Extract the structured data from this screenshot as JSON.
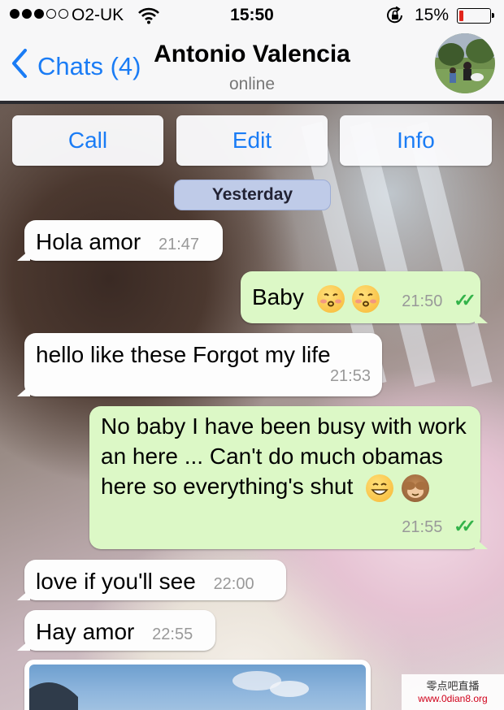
{
  "status_bar": {
    "carrier": "O2-UK",
    "signal_bars": 3,
    "signal_total": 5,
    "time": "15:50",
    "battery_text": "15%",
    "battery_level": 0.15,
    "icons": [
      "wifi-icon",
      "rotation-lock-icon",
      "battery-icon"
    ]
  },
  "nav": {
    "back_label": "Chats (4)",
    "contact_name": "Antonio Valencia",
    "contact_status": "online",
    "accent_color": "#1a7cf5"
  },
  "actions": [
    {
      "label": "Call"
    },
    {
      "label": "Edit"
    },
    {
      "label": "Info"
    }
  ],
  "date_divider": "Yesterday",
  "messages": [
    {
      "direction": "in",
      "text": "Hola amor",
      "time": "21:47",
      "emoji": []
    },
    {
      "direction": "out",
      "text": "Baby",
      "time": "21:50",
      "emoji": [
        "kissing-face",
        "kissing-face"
      ],
      "read": true
    },
    {
      "direction": "in",
      "text": "hello like these Forgot my life",
      "time": "21:53",
      "emoji": []
    },
    {
      "direction": "out",
      "text": "No baby I have been busy with work an here ... Can't do much obamas here so everything's shut",
      "time": "21:55",
      "emoji": [
        "grinning-face",
        "see-no-evil-monkey"
      ],
      "read": true
    },
    {
      "direction": "in",
      "text": "love if you'll see",
      "time": "22:00",
      "emoji": []
    },
    {
      "direction": "in",
      "text": "Hay amor",
      "time": "22:55",
      "emoji": []
    }
  ],
  "colors": {
    "incoming_bubble": "#fdfdfd",
    "outgoing_bubble": "#dcf8c6",
    "read_ticks": "#34b34a",
    "date_pill": "#bfcbe8"
  },
  "watermark": {
    "line1": "零点吧直播",
    "line2": "www.0dian8.org"
  }
}
